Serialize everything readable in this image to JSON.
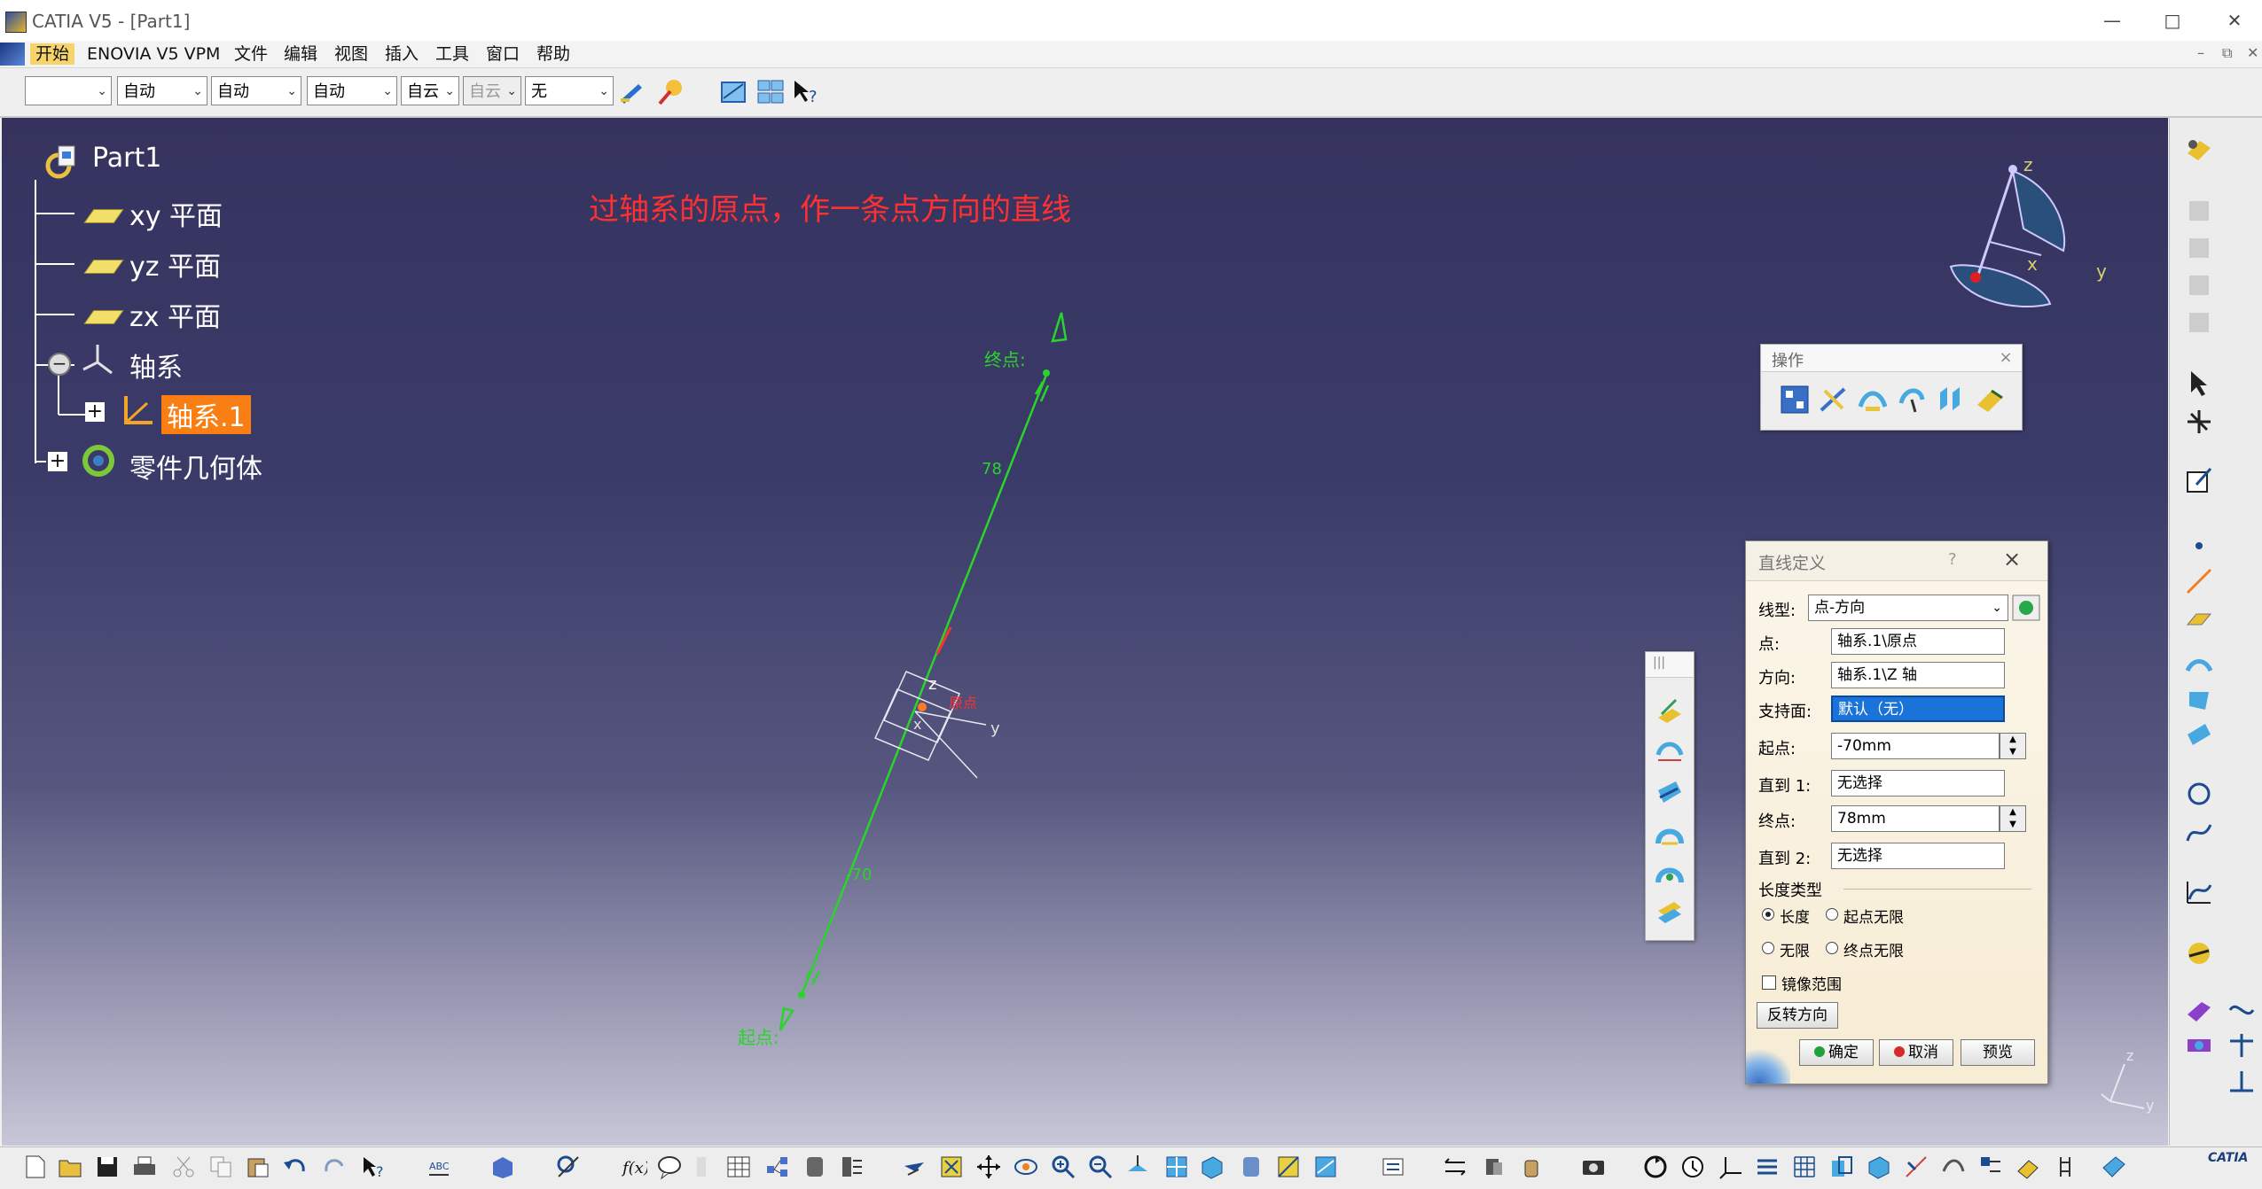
{
  "window": {
    "title": "CATIA V5 - [Part1]",
    "min_icon": "minimize-icon",
    "max_icon": "maximize-icon",
    "close_icon": "close-icon"
  },
  "menubar": {
    "items": [
      "开始",
      "ENOVIA V5 VPM",
      "文件",
      "编辑",
      "视图",
      "插入",
      "工具",
      "窗口",
      "帮助"
    ],
    "active_index": 0,
    "active_color": "#f7d46b"
  },
  "toolbar": {
    "combos": [
      {
        "value": "",
        "disabled": false
      },
      {
        "value": "自动",
        "disabled": false
      },
      {
        "value": "自动",
        "disabled": false
      },
      {
        "value": "自动",
        "disabled": false
      },
      {
        "value": "自云",
        "disabled": false
      },
      {
        "value": "自云",
        "disabled": true
      },
      {
        "value": "无",
        "disabled": false
      }
    ]
  },
  "tree": {
    "root": "Part1",
    "items": [
      {
        "label": "xy 平面",
        "icon": "plane-icon"
      },
      {
        "label": "yz 平面",
        "icon": "plane-icon"
      },
      {
        "label": "zx 平面",
        "icon": "plane-icon"
      },
      {
        "label": "轴系",
        "icon": "axis-system-icon"
      },
      {
        "label": "轴系.1",
        "icon": "axis-icon",
        "selected": true
      },
      {
        "label": "零件几何体",
        "icon": "body-icon"
      }
    ]
  },
  "annotation": {
    "text": "过轴系的原点，作一条点方向的直线",
    "color": "#ff3030"
  },
  "scene": {
    "end_label": "终点:",
    "start_label": "起点:",
    "dim_top": "78",
    "dim_bottom": "-70",
    "direction_label": "z",
    "axis_y_label": "y",
    "axis_x_label": "x",
    "red_label": "原点",
    "line_color": "#2ad42a"
  },
  "compass": {
    "z": "z",
    "x": "x",
    "y": "y"
  },
  "mini_axis": {
    "z": "z",
    "y": "y"
  },
  "ops_panel": {
    "title": "操作",
    "close": "×"
  },
  "small_toolbar": {
    "title": "|||"
  },
  "line_dialog": {
    "title": "直线定义",
    "help": "?",
    "close": "×",
    "line_type_label": "线型:",
    "line_type_value": "点-方向",
    "point_label": "点:",
    "point_value": "轴系.1\\原点",
    "direction_label": "方向:",
    "direction_value": "轴系.1\\Z 轴",
    "support_label": "支持面:",
    "support_value": "默认（无）",
    "start_label": "起点:",
    "start_value": "-70mm",
    "upto1_label": "直到 1:",
    "upto1_value": "无选择",
    "end_label": "终点:",
    "end_value": "78mm",
    "upto2_label": "直到 2:",
    "upto2_value": "无选择",
    "length_type_label": "长度类型",
    "radio_length": "长度",
    "radio_start_inf": "起点无限",
    "radio_infinite": "无限",
    "radio_end_inf": "终点无限",
    "mirror_label": "镜像范围",
    "reverse_label": "反转方向",
    "ok_label": "确定",
    "cancel_label": "取消",
    "preview_label": "预览"
  },
  "brand": {
    "logo_text": "CATIA"
  }
}
